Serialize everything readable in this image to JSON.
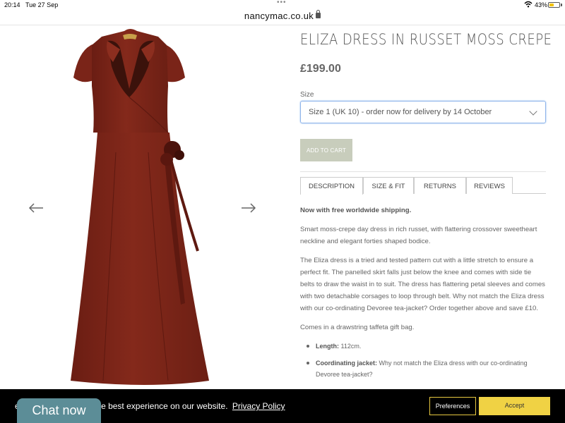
{
  "status_bar": {
    "time": "20:14",
    "date": "Tue 27 Sep",
    "battery_percent": "43%",
    "battery_level": 0.43,
    "battery_color": "#f2c200"
  },
  "browser": {
    "url": "nancymac.co.uk",
    "icons": [
      "lock-icon",
      "more-dots-icon",
      "wifi-icon",
      "battery-icon"
    ]
  },
  "product": {
    "title": "ELIZA DRESS IN RUSSET MOSS CREPE",
    "price": "£199.00",
    "dress_color": "#7a2418",
    "size_label": "Size",
    "size_selected": "Size 1 (UK 10) - order now for delivery by 14 October",
    "add_to_cart_label": "ADD TO CART"
  },
  "gallery": {
    "prev_icon": "arrow-left-icon",
    "next_icon": "arrow-right-icon"
  },
  "tabs": [
    {
      "label": "DESCRIPTION",
      "active": true
    },
    {
      "label": "SIZE & FIT",
      "active": false
    },
    {
      "label": "RETURNS",
      "active": false
    },
    {
      "label": "REVIEWS",
      "active": false
    }
  ],
  "description": {
    "lead": "Now with free worldwide shipping.",
    "para1": "Smart moss-crepe day dress in rich russet, with flattering crossover sweetheart neckline and elegant forties shaped bodice.",
    "para2": "The Eliza dress is a tried and tested pattern cut with a little stretch to ensure a perfect fit. The panelled skirt falls just below the knee and comes with side tie belts to draw the waist in to suit. The dress has flattering petal sleeves and comes with two detachable corsages to loop through belt. Why not match the Eliza dress with our co-ordinating Devoree tea-jacket? Order together above and save £10.",
    "para3": "Comes in a drawstring taffeta gift bag.",
    "bullets": [
      {
        "term": "Length:",
        "text": " 112cm."
      },
      {
        "term": "Coordinating jacket:",
        "text": " Why not match the Eliza dress with our co-ordinating Devoree tea-jacket?"
      }
    ]
  },
  "cookie_bar": {
    "text": "es to ensure you get the best experience on our website.",
    "link": "Privacy Policy",
    "preferences_label": "Preferences",
    "accept_label": "Accept",
    "accent_color": "#f0d244"
  },
  "chat": {
    "label": "Chat now",
    "color": "#5c8d97"
  }
}
